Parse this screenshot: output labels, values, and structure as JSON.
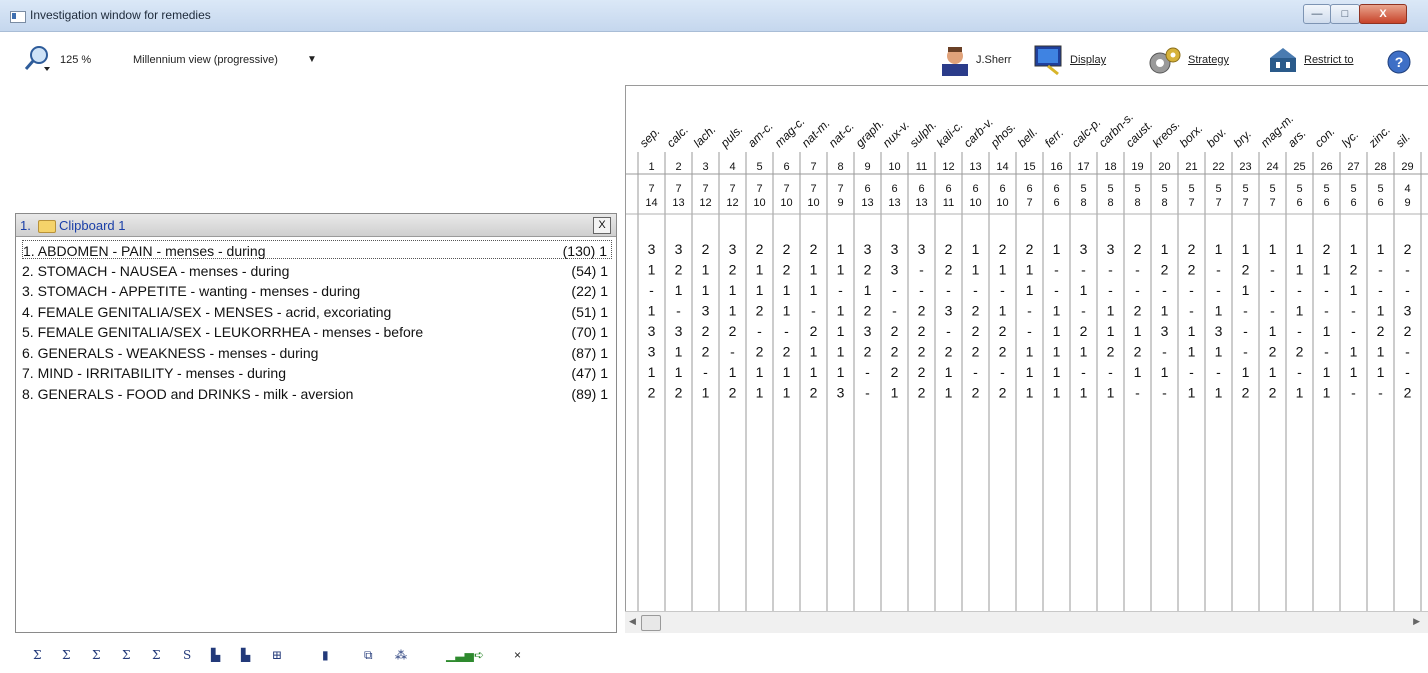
{
  "window": {
    "title": "Investigation window for remedies",
    "min_label": "—",
    "max_label": "□",
    "close_label": "X"
  },
  "toolbar": {
    "zoom": "125 %",
    "view": "Millennium view (progressive)",
    "view_arrow": "▼",
    "author": "J.Sherr",
    "display": "Display",
    "strategy": "Strategy",
    "restrict": "Restrict to",
    "help_icon": "?"
  },
  "clipboard": {
    "number": "1.",
    "name": "Clipboard 1",
    "close": "X"
  },
  "rubrics": [
    {
      "text": "1. ABDOMEN - PAIN - menses - during",
      "count": "(130) 1"
    },
    {
      "text": "2. STOMACH - NAUSEA - menses - during",
      "count": "(54) 1"
    },
    {
      "text": "3. STOMACH - APPETITE - wanting - menses - during",
      "count": "(22) 1"
    },
    {
      "text": "4. FEMALE GENITALIA/SEX - MENSES - acrid, excoriating",
      "count": "(51) 1"
    },
    {
      "text": "5. FEMALE GENITALIA/SEX - LEUKORRHEA - menses - before",
      "count": "(70) 1"
    },
    {
      "text": "6. GENERALS - WEAKNESS - menses - during",
      "count": "(87) 1"
    },
    {
      "text": "7. MIND - IRRITABILITY - menses - during",
      "count": "(47) 1"
    },
    {
      "text": "8. GENERALS - FOOD and DRINKS - milk - aversion",
      "count": "(89) 1"
    }
  ],
  "remedies": [
    {
      "name": "sep.",
      "n": "1",
      "s1": "7",
      "s2": "14"
    },
    {
      "name": "calc.",
      "n": "2",
      "s1": "7",
      "s2": "13"
    },
    {
      "name": "lach.",
      "n": "3",
      "s1": "7",
      "s2": "12"
    },
    {
      "name": "puls.",
      "n": "4",
      "s1": "7",
      "s2": "12"
    },
    {
      "name": "am-c.",
      "n": "5",
      "s1": "7",
      "s2": "10"
    },
    {
      "name": "mag-c.",
      "n": "6",
      "s1": "7",
      "s2": "10"
    },
    {
      "name": "nat-m.",
      "n": "7",
      "s1": "7",
      "s2": "10"
    },
    {
      "name": "nat-c.",
      "n": "8",
      "s1": "7",
      "s2": "9"
    },
    {
      "name": "graph.",
      "n": "9",
      "s1": "6",
      "s2": "13"
    },
    {
      "name": "nux-v.",
      "n": "10",
      "s1": "6",
      "s2": "13"
    },
    {
      "name": "sulph.",
      "n": "11",
      "s1": "6",
      "s2": "13"
    },
    {
      "name": "kali-c.",
      "n": "12",
      "s1": "6",
      "s2": "11"
    },
    {
      "name": "carb-v.",
      "n": "13",
      "s1": "6",
      "s2": "10"
    },
    {
      "name": "phos.",
      "n": "14",
      "s1": "6",
      "s2": "10"
    },
    {
      "name": "bell.",
      "n": "15",
      "s1": "6",
      "s2": "7"
    },
    {
      "name": "ferr.",
      "n": "16",
      "s1": "6",
      "s2": "6"
    },
    {
      "name": "calc-p.",
      "n": "17",
      "s1": "5",
      "s2": "8"
    },
    {
      "name": "carbn-s.",
      "n": "18",
      "s1": "5",
      "s2": "8"
    },
    {
      "name": "caust.",
      "n": "19",
      "s1": "5",
      "s2": "8"
    },
    {
      "name": "kreos.",
      "n": "20",
      "s1": "5",
      "s2": "8"
    },
    {
      "name": "borx.",
      "n": "21",
      "s1": "5",
      "s2": "7"
    },
    {
      "name": "bov.",
      "n": "22",
      "s1": "5",
      "s2": "7"
    },
    {
      "name": "bry.",
      "n": "23",
      "s1": "5",
      "s2": "7"
    },
    {
      "name": "mag-m.",
      "n": "24",
      "s1": "5",
      "s2": "7"
    },
    {
      "name": "ars.",
      "n": "25",
      "s1": "5",
      "s2": "6"
    },
    {
      "name": "con.",
      "n": "26",
      "s1": "5",
      "s2": "6"
    },
    {
      "name": "lyc.",
      "n": "27",
      "s1": "5",
      "s2": "6"
    },
    {
      "name": "zinc.",
      "n": "28",
      "s1": "5",
      "s2": "6"
    },
    {
      "name": "sil.",
      "n": "29",
      "s1": "4",
      "s2": "9"
    }
  ],
  "grid": [
    [
      "3",
      "3",
      "2",
      "3",
      "2",
      "2",
      "2",
      "1",
      "3",
      "3",
      "3",
      "2",
      "1",
      "2",
      "2",
      "1",
      "3",
      "3",
      "2",
      "1",
      "2",
      "1",
      "1",
      "1",
      "1",
      "2",
      "1",
      "1",
      "2"
    ],
    [
      "1",
      "2",
      "1",
      "2",
      "1",
      "2",
      "1",
      "1",
      "2",
      "3",
      "-",
      "2",
      "1",
      "1",
      "1",
      "-",
      "-",
      "-",
      "-",
      "2",
      "2",
      "-",
      "2",
      "-",
      "1",
      "1",
      "2",
      "-",
      "-"
    ],
    [
      "-",
      "1",
      "1",
      "1",
      "1",
      "1",
      "1",
      "-",
      "1",
      "-",
      "-",
      "-",
      "-",
      "-",
      "1",
      "-",
      "1",
      "-",
      "-",
      "-",
      "-",
      "-",
      "1",
      "-",
      "-",
      "-",
      "1",
      "-",
      "-"
    ],
    [
      "1",
      "-",
      "3",
      "1",
      "2",
      "1",
      "-",
      "1",
      "2",
      "-",
      "2",
      "3",
      "2",
      "1",
      "-",
      "1",
      "-",
      "1",
      "2",
      "1",
      "-",
      "1",
      "-",
      "-",
      "1",
      "-",
      "-",
      "1",
      "3"
    ],
    [
      "3",
      "3",
      "2",
      "2",
      "-",
      "-",
      "2",
      "1",
      "3",
      "2",
      "2",
      "-",
      "2",
      "2",
      "-",
      "1",
      "2",
      "1",
      "1",
      "3",
      "1",
      "3",
      "-",
      "1",
      "-",
      "1",
      "-",
      "2",
      "2"
    ],
    [
      "3",
      "1",
      "2",
      "-",
      "2",
      "2",
      "1",
      "1",
      "2",
      "2",
      "2",
      "2",
      "2",
      "2",
      "1",
      "1",
      "1",
      "2",
      "2",
      "-",
      "1",
      "1",
      "-",
      "2",
      "2",
      "-",
      "1",
      "1",
      "-"
    ],
    [
      "1",
      "1",
      "-",
      "1",
      "1",
      "1",
      "1",
      "1",
      "-",
      "2",
      "2",
      "1",
      "-",
      "-",
      "1",
      "1",
      "-",
      "-",
      "1",
      "1",
      "-",
      "-",
      "1",
      "1",
      "-",
      "1",
      "1",
      "1",
      "-"
    ],
    [
      "2",
      "2",
      "1",
      "2",
      "1",
      "1",
      "2",
      "3",
      "-",
      "1",
      "2",
      "1",
      "2",
      "2",
      "1",
      "1",
      "1",
      "1",
      "-",
      "-",
      "1",
      "1",
      "2",
      "2",
      "1",
      "1",
      "-",
      "-",
      "2"
    ]
  ],
  "bottom_icons": [
    "sigma-1",
    "sigma-2",
    "sigma-3",
    "sigma-4",
    "sigma-5",
    "sigma-6",
    "chart-1",
    "chart-2",
    "table",
    "bar",
    "copy",
    "grid",
    "green-chart",
    "arrow-icon",
    "close-x"
  ],
  "bottom_glyphs": [
    "Σ",
    "Σ",
    "Σ",
    "Σ",
    "Σ",
    "S",
    "▙",
    "▙",
    "⊞",
    "▮",
    "⧉",
    "⁂",
    "▁▃▅",
    "➪",
    "×"
  ],
  "colors": {
    "title_blue": "#1a3fa8",
    "close_red": "#c7432a"
  }
}
